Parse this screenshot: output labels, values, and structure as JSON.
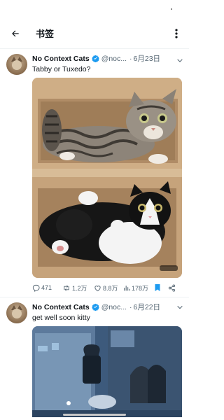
{
  "header": {
    "title": "书签"
  },
  "tweets": [
    {
      "name": "No Context Cats",
      "handle": "@noc...",
      "separator": "·",
      "date": "6月23日",
      "text": "Tabby or Tuxedo?",
      "stats": {
        "replies": "471",
        "retweets": "1.2万",
        "likes": "8.8万",
        "views": "178万"
      },
      "bookmarked": true
    },
    {
      "name": "No Context Cats",
      "handle": "@noc...",
      "separator": "·",
      "date": "6月22日",
      "text": "get well soon kitty"
    }
  ],
  "colors": {
    "accent": "#1d9bf0",
    "muted": "#536471",
    "text": "#0f1419"
  },
  "icons": [
    "back-arrow-icon",
    "more-vertical-icon",
    "verified-badge-icon",
    "chevron-down-icon",
    "reply-icon",
    "retweet-icon",
    "like-icon",
    "views-icon",
    "bookmark-icon",
    "share-icon"
  ]
}
